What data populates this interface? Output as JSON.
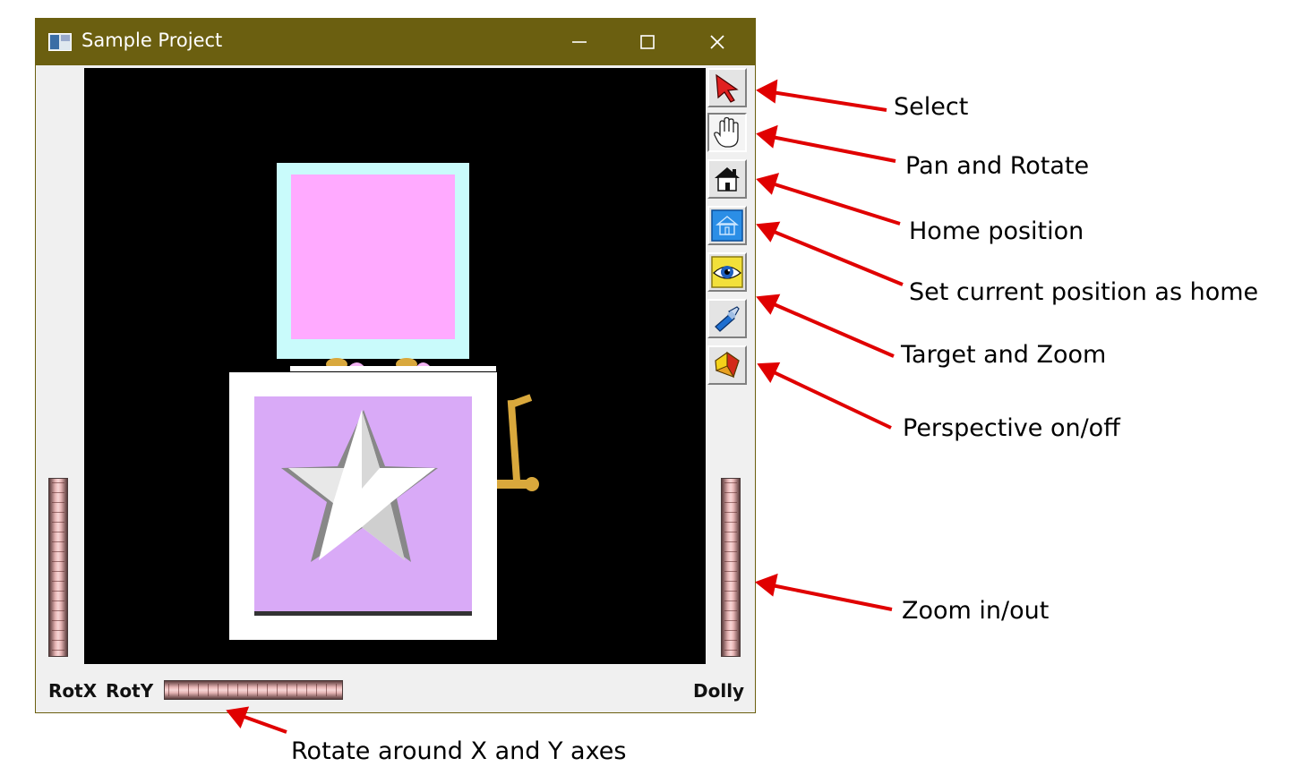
{
  "window": {
    "title": "Sample Project",
    "minimize_glyph": "—",
    "maximize_glyph": "☐",
    "close_glyph": "✕"
  },
  "toolbar": {
    "buttons": [
      {
        "name": "select",
        "icon": "arrow-cursor-icon",
        "pressed": false
      },
      {
        "name": "pan-rotate",
        "icon": "hand-icon",
        "pressed": true
      },
      {
        "name": "home",
        "icon": "house-icon",
        "pressed": false
      },
      {
        "name": "set-home",
        "icon": "blue-house-icon",
        "pressed": false
      },
      {
        "name": "target-zoom",
        "icon": "eye-target-icon",
        "pressed": false
      },
      {
        "name": "perspective",
        "icon": "flashlight-icon",
        "pressed": false
      },
      {
        "name": "perspective-toggle",
        "icon": "cube-icon",
        "pressed": false
      }
    ]
  },
  "bottom": {
    "rotx": "RotX",
    "roty": "RotY",
    "dolly": "Dolly"
  },
  "callouts": {
    "select": "Select",
    "pan_rotate": "Pan and Rotate",
    "home": "Home position",
    "set_home": "Set current position as home",
    "target_zoom": "Target and Zoom",
    "perspective": "Perspective on/off",
    "zoom": "Zoom in/out",
    "rotate_xy": "Rotate around X and Y axes"
  },
  "colors": {
    "titlebar": "#6b5f10",
    "arrow": "#e00000",
    "viewport": "#000000",
    "box_top_outer": "#c9fbfb",
    "box_top_inner": "#ffaaff",
    "box_bottom_outer": "#ffffff",
    "box_bottom_inner": "#d9aaf7",
    "crank": "#d9a83c"
  }
}
